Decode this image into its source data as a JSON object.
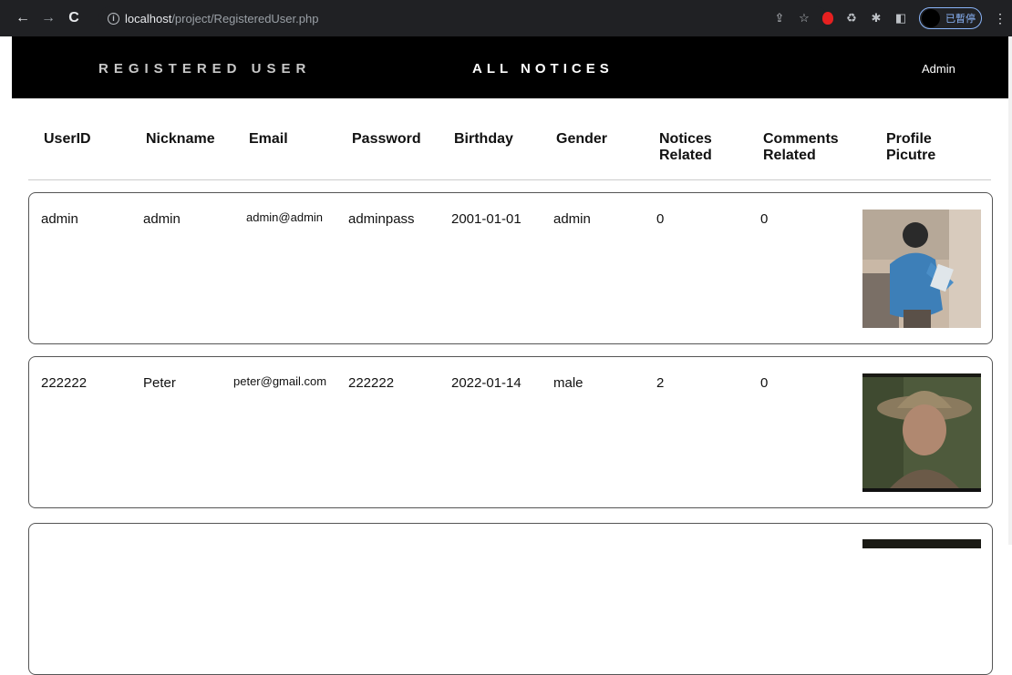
{
  "browser": {
    "url_host": "localhost",
    "url_path": "/project/RegisteredUser.php",
    "profile_status": "已暫停"
  },
  "nav": {
    "registered_user": "REGISTERED USER",
    "all_notices": "ALL NOTICES",
    "admin": "Admin"
  },
  "table": {
    "headers": [
      "UserID",
      "Nickname",
      "Email",
      "Password",
      "Birthday",
      "Gender",
      "Notices\nRelated",
      "Comments\nRelated",
      "Profile\nPicutre"
    ],
    "rows": [
      {
        "userid": "admin",
        "nickname": "admin",
        "email": "admin@admin",
        "password": "adminpass",
        "birthday": "2001-01-01",
        "gender": "admin",
        "notices": "0",
        "comments": "0",
        "picture": "man-with-tablet-photo"
      },
      {
        "userid": "222222",
        "nickname": "Peter",
        "email": "peter@gmail.com",
        "password": "222222",
        "birthday": "2022-01-14",
        "gender": "male",
        "notices": "2",
        "comments": "0",
        "picture": "man-with-hat-photo"
      }
    ]
  },
  "colors": {
    "header_bg": "#000000",
    "chrome_bg": "#202124",
    "accent": "#8ab4f8"
  }
}
